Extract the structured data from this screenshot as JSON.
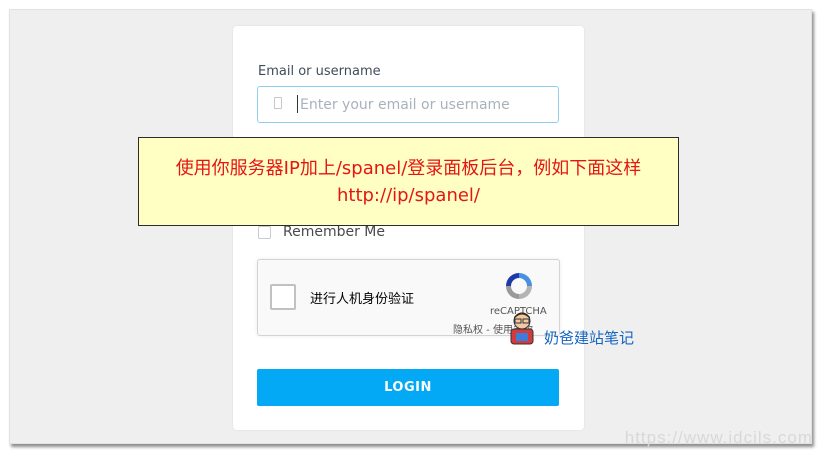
{
  "login_form": {
    "email_label": "Email or username",
    "email_placeholder": "Enter your email or username",
    "email_value": "",
    "remember_label": "Remember Me",
    "login_label": "LOGIN"
  },
  "recaptcha": {
    "label": "进行人机身份验证",
    "brand": "reCAPTCHA",
    "links": "隐私权 - 使用条款"
  },
  "annotation": {
    "line1": "使用你服务器IP加上/spanel/登录面板后台，例如下面这样",
    "line2": "http://ip/spanel/"
  },
  "watermark": {
    "name": "奶爸建站笔记",
    "url": "https://www.idcils.com"
  },
  "colors": {
    "accent": "#03a9f4",
    "note_text": "#e61515",
    "note_bg": "#ffffc3",
    "input_border": "#8fd0ef"
  }
}
